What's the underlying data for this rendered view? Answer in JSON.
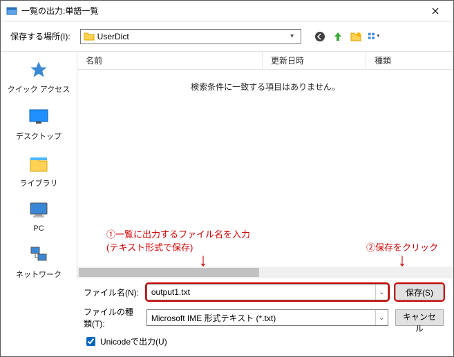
{
  "title": "一覧の出力:単語一覧",
  "toolbar": {
    "location_label": "保存する場所(I):",
    "location_value": "UserDict"
  },
  "sidebar": [
    {
      "name": "quick-access",
      "label": "クイック アクセス"
    },
    {
      "name": "desktop",
      "label": "デスクトップ"
    },
    {
      "name": "libraries",
      "label": "ライブラリ"
    },
    {
      "name": "pc",
      "label": "PC"
    },
    {
      "name": "network",
      "label": "ネットワーク"
    }
  ],
  "columns": {
    "name": "名前",
    "date": "更新日時",
    "type": "種類"
  },
  "nomatch": "検索条件に一致する項目はありません。",
  "annotations": {
    "a1_line1": "①一覧に出力するファイル名を入力",
    "a1_line2": "(テキスト形式で保存)",
    "a2": "②保存をクリック",
    "arrow": "↓"
  },
  "footer": {
    "filename_label": "ファイル名(N):",
    "filename_value": "output1.txt",
    "filetype_label": "ファイルの種類(T):",
    "filetype_value": "Microsoft IME 形式テキスト (*.txt)",
    "save_label": "保存(S)",
    "cancel_label": "キャンセル",
    "unicode_label": "Unicodeで出力(U)"
  }
}
